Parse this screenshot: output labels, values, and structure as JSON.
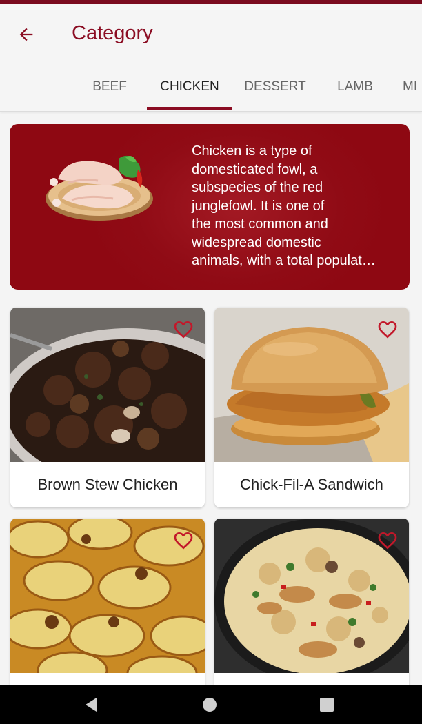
{
  "app_bar": {
    "title": "Category",
    "back_icon": "arrow-left-icon",
    "accent_color": "#8b0d23"
  },
  "tabs": [
    {
      "label": "BEEF",
      "active": false
    },
    {
      "label": "CHICKEN",
      "active": true
    },
    {
      "label": "DESSERT",
      "active": false
    },
    {
      "label": "LAMB",
      "active": false
    },
    {
      "label": "MI",
      "active": false
    }
  ],
  "category": {
    "image_icon": "raw-chicken-plate-image",
    "description_lines": [
      "Chicken is a type of",
      "domesticated fowl, a",
      "subspecies of the red",
      "junglefowl. It is one of",
      "the most common and",
      "widespread domestic",
      "animals, with a total populat…"
    ],
    "banner_color": "#8e0812"
  },
  "meals": [
    {
      "name": "Brown Stew Chicken",
      "favorite_icon": "heart-outline-icon"
    },
    {
      "name": "Chick-Fil-A Sandwich",
      "favorite_icon": "heart-outline-icon"
    },
    {
      "name": "",
      "favorite_icon": "heart-outline-icon"
    },
    {
      "name": "",
      "favorite_icon": "heart-outline-icon"
    }
  ],
  "nav": {
    "back_icon": "triangle-back-icon",
    "home_icon": "circle-home-icon",
    "recents_icon": "square-recents-icon"
  }
}
